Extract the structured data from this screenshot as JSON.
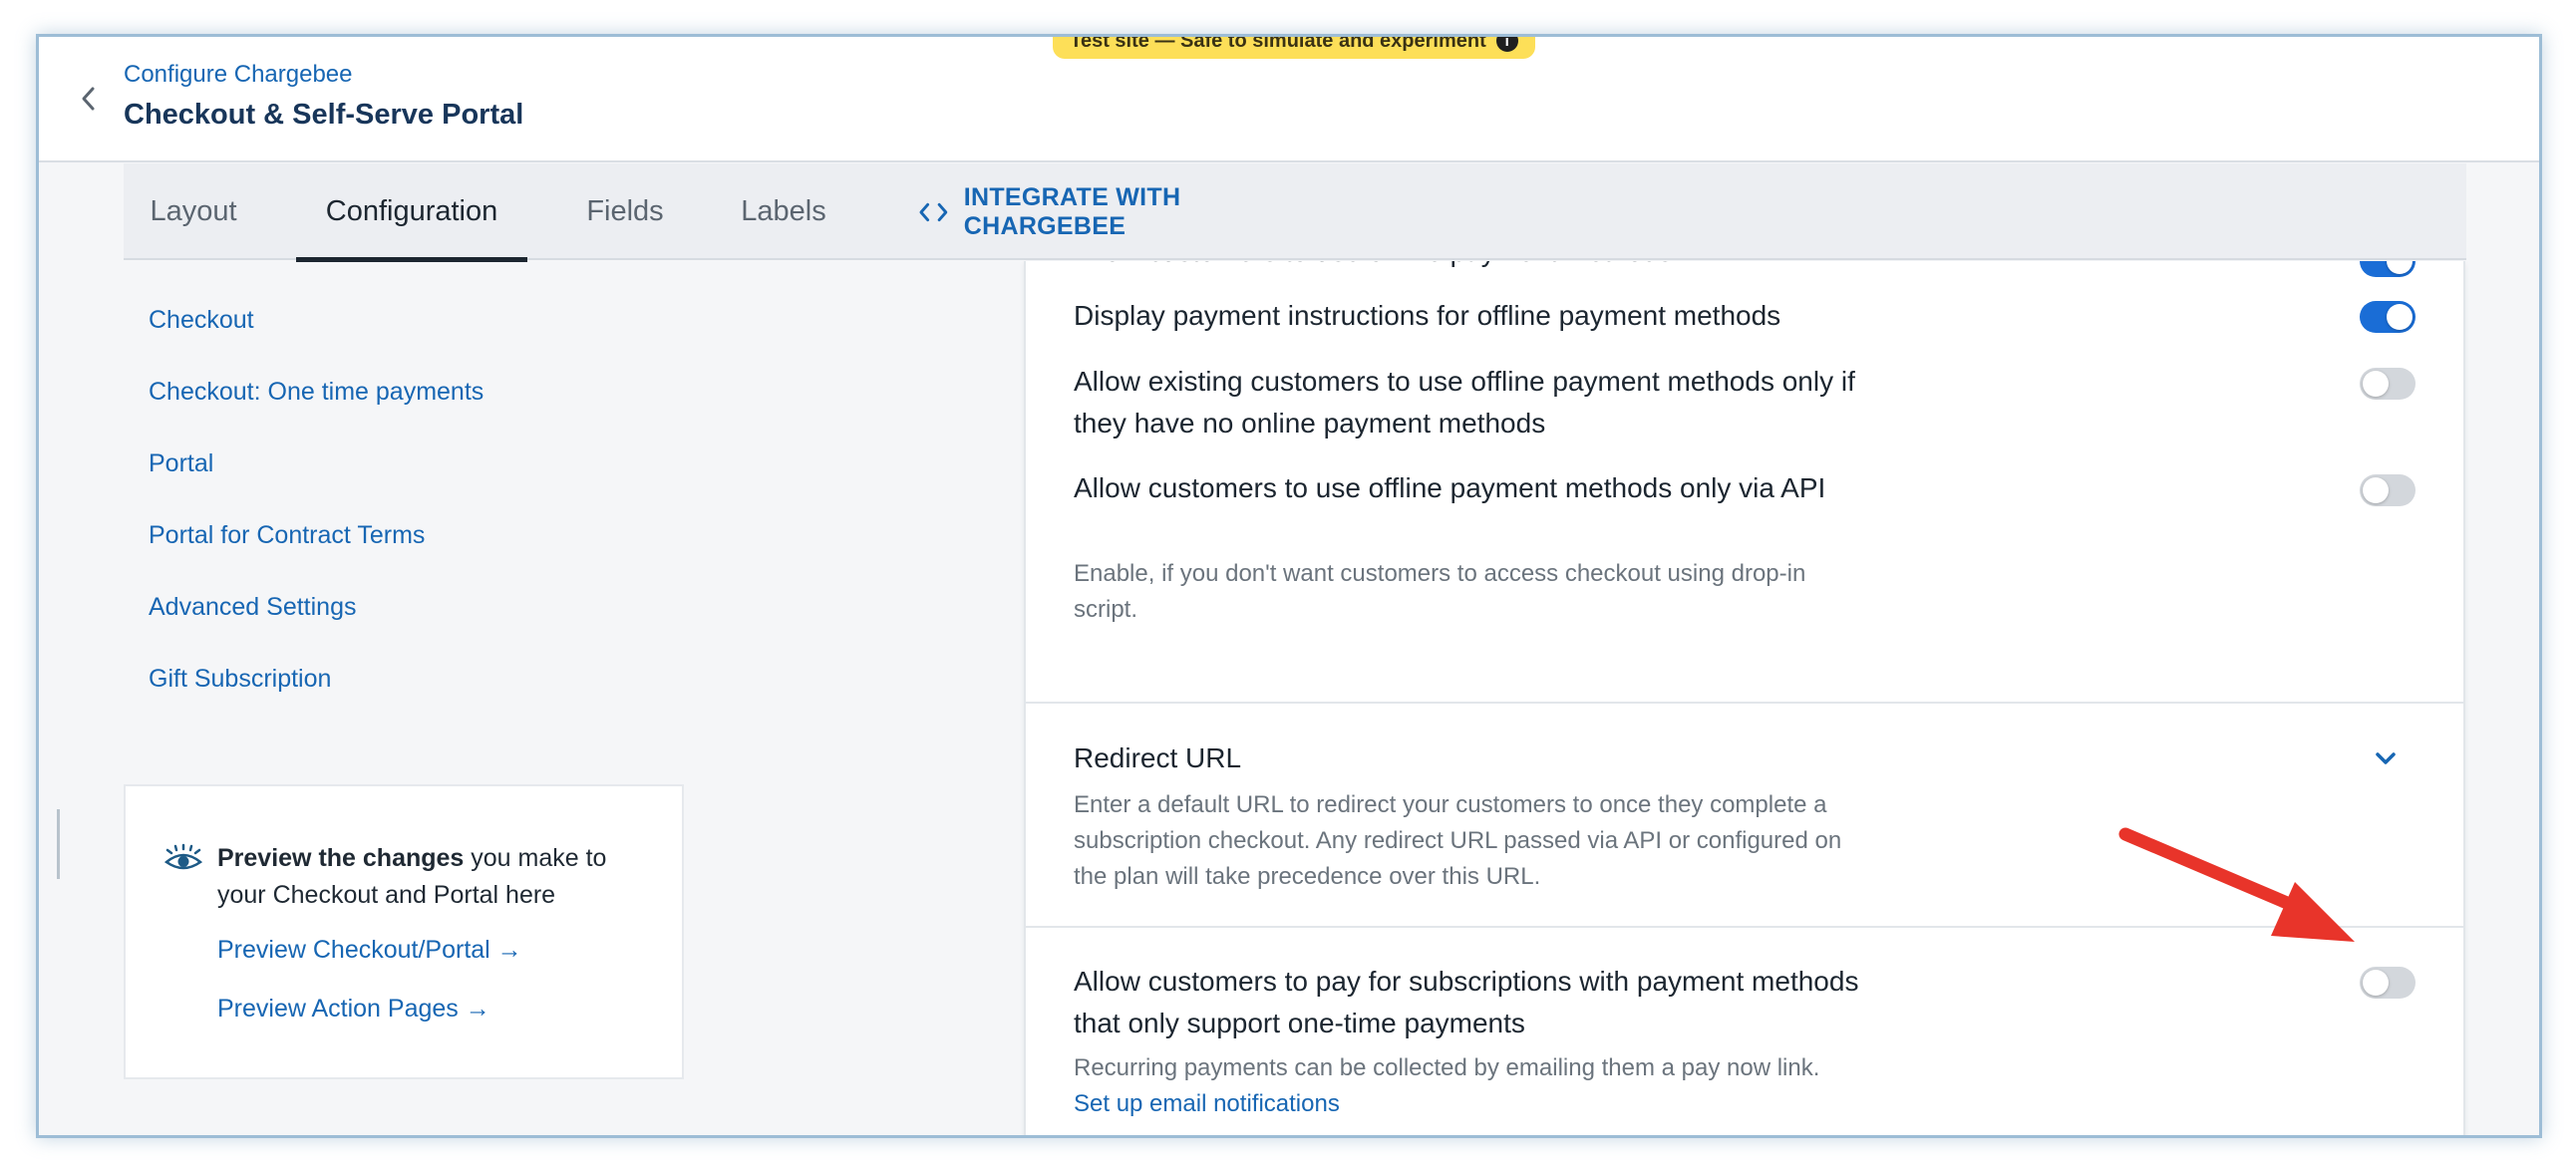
{
  "header": {
    "breadcrumb": "Configure Chargebee",
    "title": "Checkout & Self-Serve Portal",
    "banner": "Test site — Safe to simulate and experiment",
    "banner_info_icon": "info-icon"
  },
  "tabs": [
    {
      "label": "Layout",
      "active": false
    },
    {
      "label": "Configuration",
      "active": true
    },
    {
      "label": "Fields",
      "active": false
    },
    {
      "label": "Labels",
      "active": false
    },
    {
      "label": "INTEGRATE WITH CHARGEBEE",
      "active": false,
      "icon": "code-icon"
    }
  ],
  "sidebar": {
    "items": [
      {
        "label": "Checkout"
      },
      {
        "label": "Checkout: One time payments"
      },
      {
        "label": "Portal"
      },
      {
        "label": "Portal for Contract Terms"
      },
      {
        "label": "Advanced Settings"
      },
      {
        "label": "Gift Subscription"
      }
    ]
  },
  "preview": {
    "icon": "eye-icon",
    "bold": "Preview the changes",
    "rest": " you make to your Checkout and Portal here",
    "link1": "Preview Checkout/Portal →",
    "link2": "Preview Action Pages →"
  },
  "settings": {
    "cutoff_label": "Allow customers to use offline payment methods",
    "cutoff_on": true,
    "display_instructions": {
      "label": "Display payment instructions for offline payment methods",
      "on": true
    },
    "existing_offline": {
      "label": "Allow existing customers to use offline payment methods only if they have no online payment methods",
      "on": false
    },
    "offline_api": {
      "label": "Allow customers to use offline payment methods only via API",
      "description": "Enable, if you don't want customers to access checkout using drop-in script.",
      "on": false
    },
    "redirect": {
      "title": "Redirect URL",
      "description": "Enter a default URL to redirect your customers to once they complete a subscription checkout. Any redirect URL passed via API or configured on the plan will take precedence over this URL.",
      "icon": "chevron-down-icon"
    },
    "one_time": {
      "label": "Allow customers to pay for subscriptions with payment methods that only support one-time payments",
      "description": "Recurring payments can be collected by emailing them a pay now link. ",
      "link": "Set up email notifications",
      "on": false
    }
  },
  "colors": {
    "accent": "#1766b3",
    "toggle_on": "#1a6dd6",
    "banner": "#fddf58",
    "annotation_arrow": "#e8342a"
  }
}
